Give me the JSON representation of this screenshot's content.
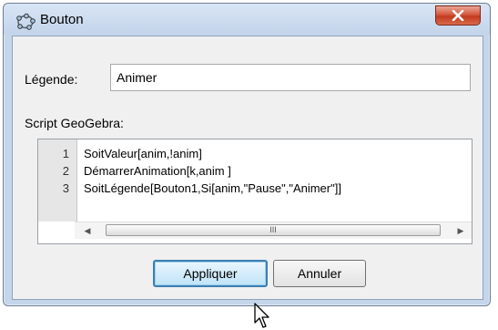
{
  "window": {
    "title": "Bouton",
    "icons": {
      "app": "geogebra-icon",
      "close": "close-icon"
    }
  },
  "form": {
    "caption_label": "Légende:",
    "caption_value": "Animer",
    "script_label": "Script GeoGebra:"
  },
  "script": {
    "line_numbers": [
      "1",
      "2",
      "3"
    ],
    "lines": [
      "SoitValeur[anim,!anim]",
      "DémarrerAnimation[k,anim ]",
      "SoitLégende[Bouton1,Si[anim,\"Pause\",\"Animer\"]]"
    ],
    "scroll_thumb_grip": "III"
  },
  "buttons": {
    "apply": "Appliquer",
    "cancel": "Annuler"
  }
}
